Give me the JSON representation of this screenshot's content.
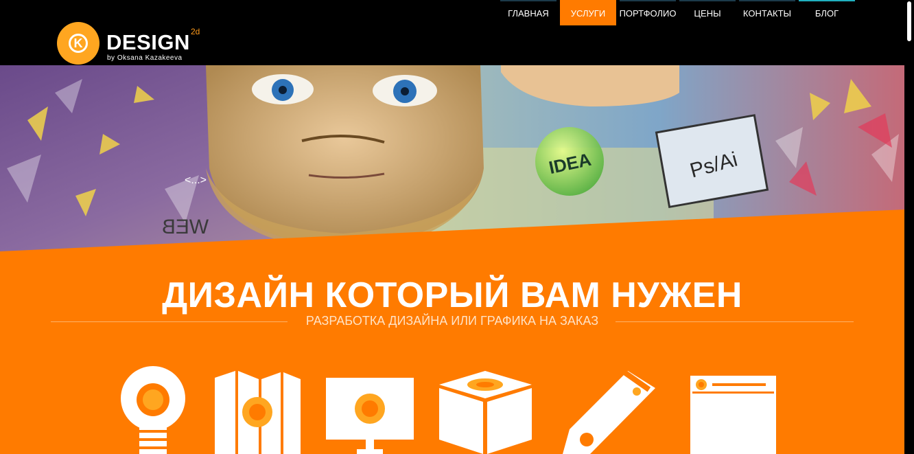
{
  "logo": {
    "word": "DESIGN",
    "sup": "2d",
    "byline": "by Oksana Kazakeeva"
  },
  "nav": {
    "items": [
      {
        "label": "ГЛАВНАЯ"
      },
      {
        "label": "УСЛУГИ"
      },
      {
        "label": "ПОРТФОЛИО"
      },
      {
        "label": "ЦЕНЫ"
      },
      {
        "label": "КОНТАКТЫ"
      },
      {
        "label": "БЛОГ"
      }
    ]
  },
  "hero": {
    "idea_bubble": "IDEA",
    "psai_label": "Ps/Ai",
    "web_mirrored": "WEB",
    "code_tag": "<...>"
  },
  "main": {
    "headline": "ДИЗАЙН КОТОРЫЙ ВАМ НУЖЕН",
    "subheadline": "РАЗРАБОТКА ДИЗАЙНА ИЛИ ГРАФИКА НА ЗАКАЗ"
  },
  "colors": {
    "accent": "#ff7b00",
    "logo_circle": "#ffa620",
    "header_bg": "#000000"
  }
}
